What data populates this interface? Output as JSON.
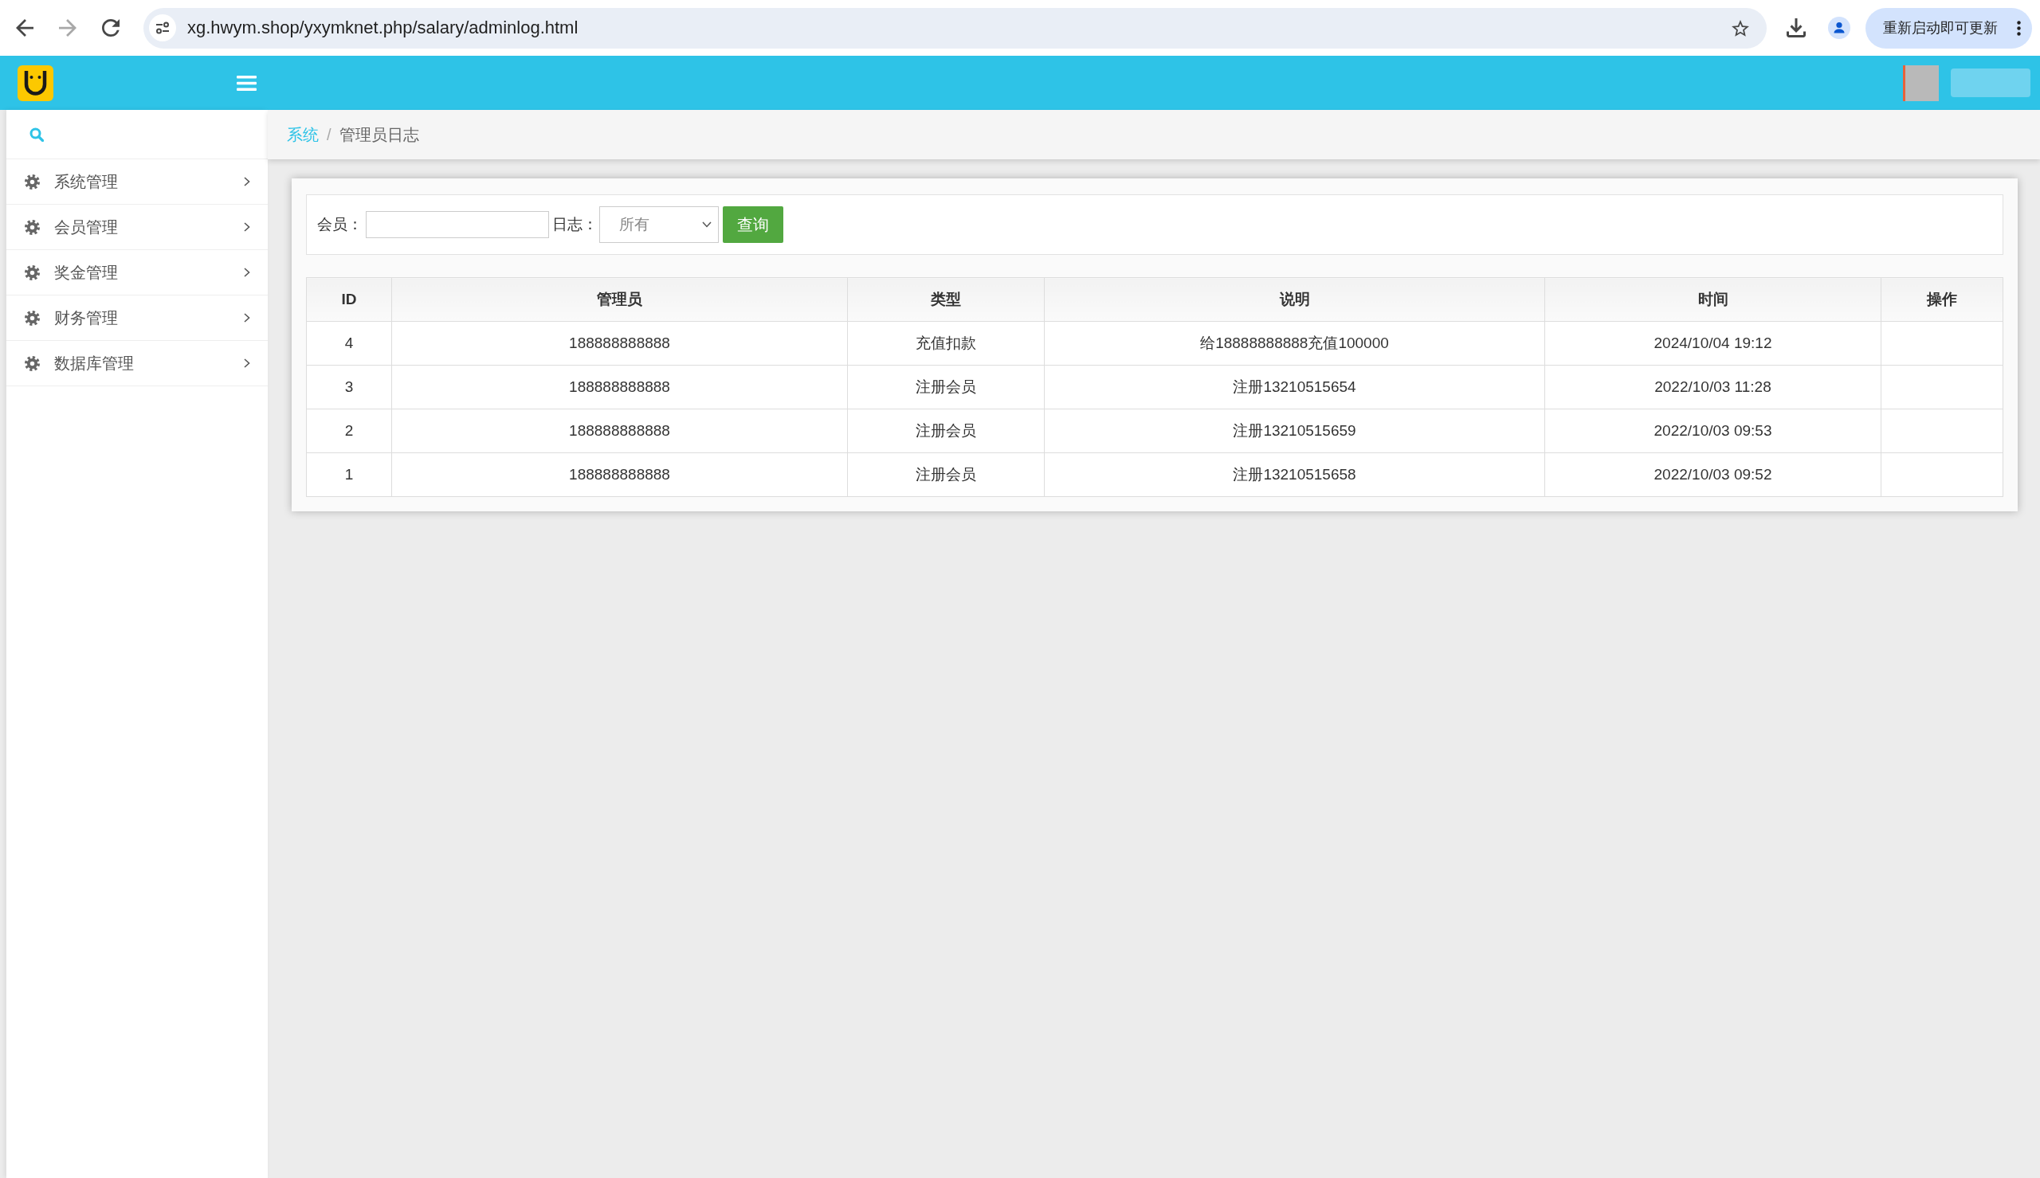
{
  "browser": {
    "url": "xg.hwym.shop/yxymknet.php/salary/adminlog.html",
    "forward_disabled": true,
    "update_button": "重新启动即可更新"
  },
  "sidebar": {
    "items": [
      {
        "label": "系统管理",
        "expanded": false
      },
      {
        "label": "会员管理",
        "expanded": false
      },
      {
        "label": "奖金管理",
        "expanded": false
      },
      {
        "label": "财务管理",
        "expanded": false
      },
      {
        "label": "数据库管理",
        "expanded": false
      }
    ]
  },
  "breadcrumb": {
    "items": [
      {
        "label": "系统",
        "kind": "link"
      },
      {
        "label": "管理员日志",
        "kind": "current"
      }
    ],
    "separator": "/"
  },
  "filter": {
    "member_label": "会员：",
    "log_label": "日志：",
    "log_select": "所有",
    "search_button": "查询"
  },
  "table": {
    "columns": [
      "ID",
      "管理员",
      "类型",
      "说明",
      "时间",
      "操作"
    ],
    "rows": [
      {
        "id": "4",
        "admin": "188888888888",
        "type": "充值扣款",
        "note": "给18888888888充值100000",
        "time": "2024/10/04 19:12"
      },
      {
        "id": "3",
        "admin": "188888888888",
        "type": "注册会员",
        "note": "注册13210515654",
        "time": "2022/10/03 11:28"
      },
      {
        "id": "2",
        "admin": "188888888888",
        "type": "注册会员",
        "note": "注册13210515659",
        "time": "2022/10/03 09:53"
      },
      {
        "id": "1",
        "admin": "188888888888",
        "type": "注册会员",
        "note": "注册13210515658",
        "time": "2022/10/03 09:52"
      }
    ]
  }
}
